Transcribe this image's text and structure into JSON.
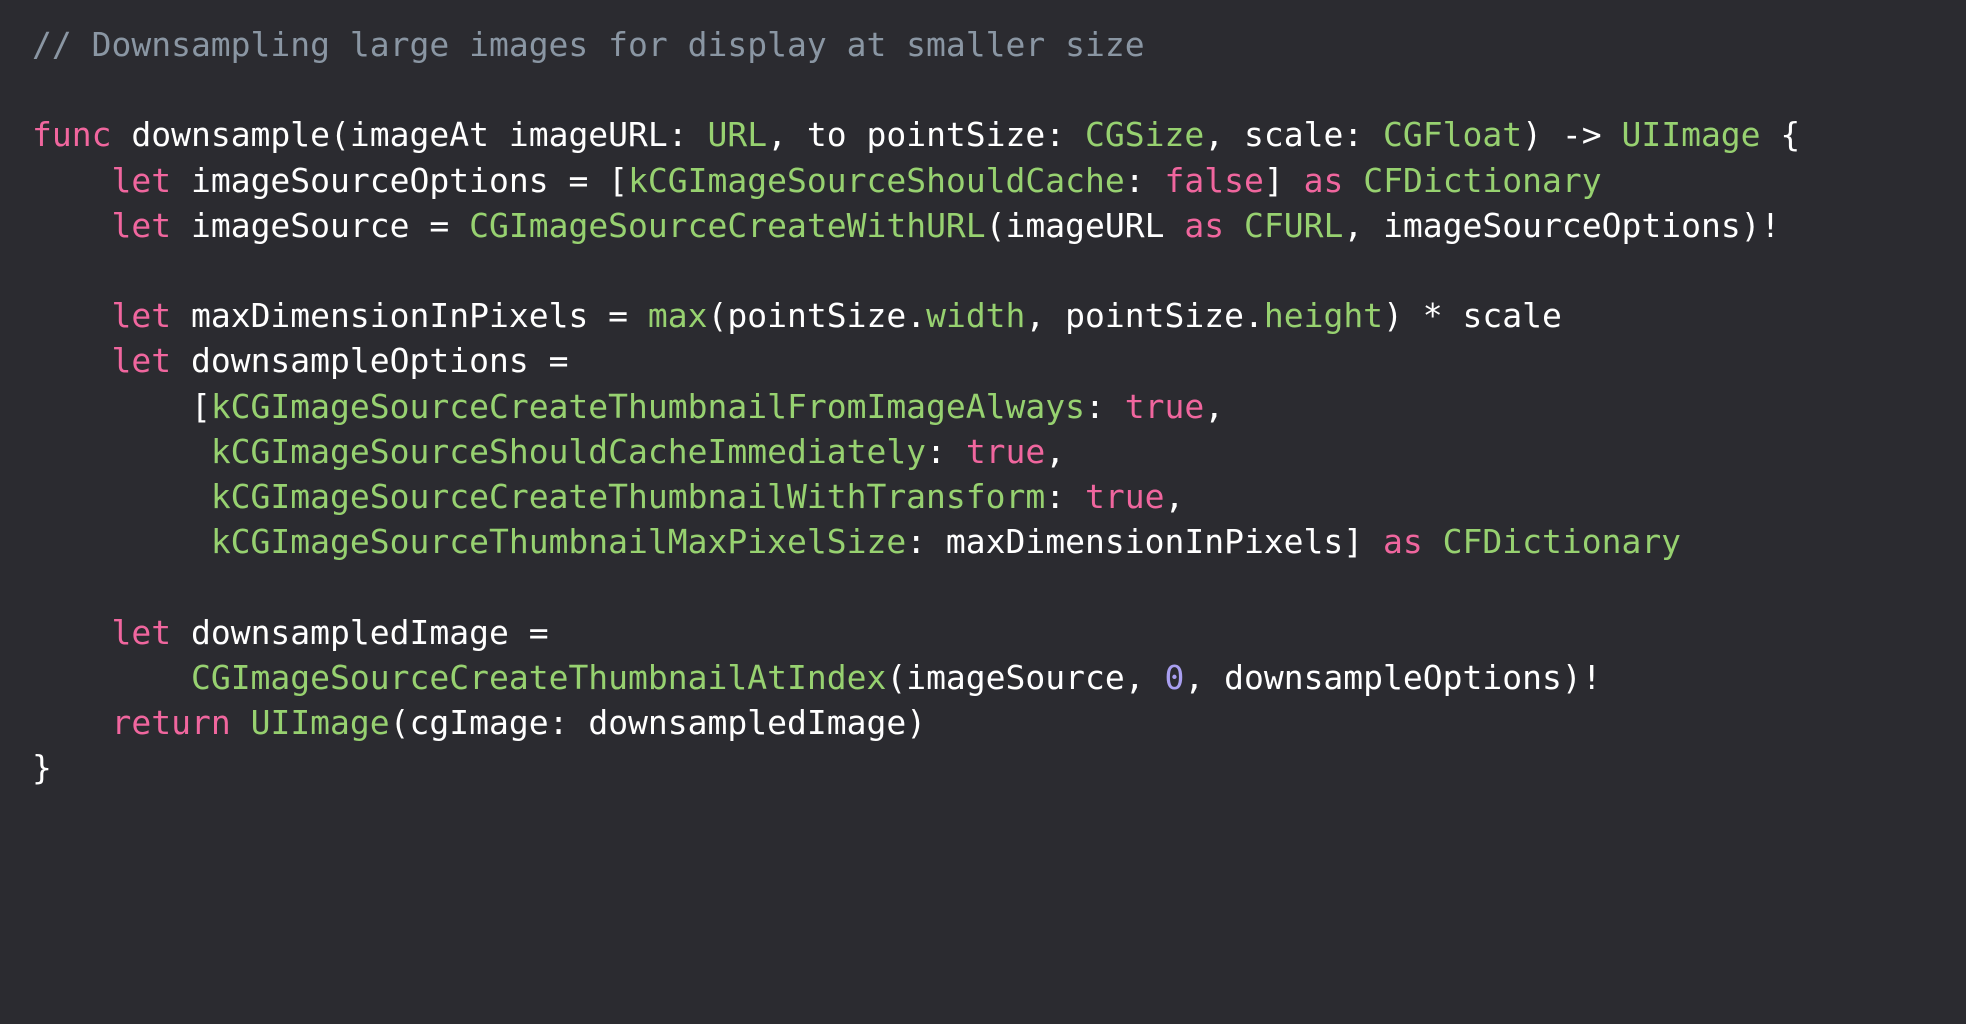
{
  "colors": {
    "background": "#2b2b30",
    "comment": "#8a96a3",
    "keyword": "#f0669e",
    "plain": "#ffffff",
    "type": "#97d170",
    "number": "#a99ff0"
  },
  "code": {
    "lines": [
      [
        {
          "t": "// Downsampling large images for display at smaller size",
          "k": "comment"
        }
      ],
      [],
      [
        {
          "t": "func",
          "k": "keyword"
        },
        {
          "t": " downsample(imageAt imageURL: ",
          "k": "plain"
        },
        {
          "t": "URL",
          "k": "type"
        },
        {
          "t": ", to pointSize: ",
          "k": "plain"
        },
        {
          "t": "CGSize",
          "k": "type"
        },
        {
          "t": ", scale: ",
          "k": "plain"
        },
        {
          "t": "CGFloat",
          "k": "type"
        },
        {
          "t": ") -> ",
          "k": "plain"
        },
        {
          "t": "UIImage",
          "k": "type"
        },
        {
          "t": " {",
          "k": "plain"
        }
      ],
      [
        {
          "t": "    ",
          "k": "plain"
        },
        {
          "t": "let",
          "k": "keyword"
        },
        {
          "t": " imageSourceOptions = [",
          "k": "plain"
        },
        {
          "t": "kCGImageSourceShouldCache",
          "k": "type"
        },
        {
          "t": ": ",
          "k": "plain"
        },
        {
          "t": "false",
          "k": "keyword"
        },
        {
          "t": "] ",
          "k": "plain"
        },
        {
          "t": "as",
          "k": "keyword"
        },
        {
          "t": " ",
          "k": "plain"
        },
        {
          "t": "CFDictionary",
          "k": "type"
        }
      ],
      [
        {
          "t": "    ",
          "k": "plain"
        },
        {
          "t": "let",
          "k": "keyword"
        },
        {
          "t": " imageSource = ",
          "k": "plain"
        },
        {
          "t": "CGImageSourceCreateWithURL",
          "k": "type"
        },
        {
          "t": "(imageURL ",
          "k": "plain"
        },
        {
          "t": "as",
          "k": "keyword"
        },
        {
          "t": " ",
          "k": "plain"
        },
        {
          "t": "CFURL",
          "k": "type"
        },
        {
          "t": ", imageSourceOptions)!",
          "k": "plain"
        }
      ],
      [],
      [
        {
          "t": "    ",
          "k": "plain"
        },
        {
          "t": "let",
          "k": "keyword"
        },
        {
          "t": " maxDimensionInPixels = ",
          "k": "plain"
        },
        {
          "t": "max",
          "k": "type"
        },
        {
          "t": "(pointSize.",
          "k": "plain"
        },
        {
          "t": "width",
          "k": "type"
        },
        {
          "t": ", pointSize.",
          "k": "plain"
        },
        {
          "t": "height",
          "k": "type"
        },
        {
          "t": ") * scale",
          "k": "plain"
        }
      ],
      [
        {
          "t": "    ",
          "k": "plain"
        },
        {
          "t": "let",
          "k": "keyword"
        },
        {
          "t": " downsampleOptions =",
          "k": "plain"
        }
      ],
      [
        {
          "t": "        [",
          "k": "plain"
        },
        {
          "t": "kCGImageSourceCreateThumbnailFromImageAlways",
          "k": "type"
        },
        {
          "t": ": ",
          "k": "plain"
        },
        {
          "t": "true",
          "k": "keyword"
        },
        {
          "t": ",",
          "k": "plain"
        }
      ],
      [
        {
          "t": "         ",
          "k": "plain"
        },
        {
          "t": "kCGImageSourceShouldCacheImmediately",
          "k": "type"
        },
        {
          "t": ": ",
          "k": "plain"
        },
        {
          "t": "true",
          "k": "keyword"
        },
        {
          "t": ",",
          "k": "plain"
        }
      ],
      [
        {
          "t": "         ",
          "k": "plain"
        },
        {
          "t": "kCGImageSourceCreateThumbnailWithTransform",
          "k": "type"
        },
        {
          "t": ": ",
          "k": "plain"
        },
        {
          "t": "true",
          "k": "keyword"
        },
        {
          "t": ",",
          "k": "plain"
        }
      ],
      [
        {
          "t": "         ",
          "k": "plain"
        },
        {
          "t": "kCGImageSourceThumbnailMaxPixelSize",
          "k": "type"
        },
        {
          "t": ": maxDimensionInPixels] ",
          "k": "plain"
        },
        {
          "t": "as",
          "k": "keyword"
        },
        {
          "t": " ",
          "k": "plain"
        },
        {
          "t": "CFDictionary",
          "k": "type"
        }
      ],
      [],
      [
        {
          "t": "    ",
          "k": "plain"
        },
        {
          "t": "let",
          "k": "keyword"
        },
        {
          "t": " downsampledImage =",
          "k": "plain"
        }
      ],
      [
        {
          "t": "        ",
          "k": "plain"
        },
        {
          "t": "CGImageSourceCreateThumbnailAtIndex",
          "k": "type"
        },
        {
          "t": "(imageSource, ",
          "k": "plain"
        },
        {
          "t": "0",
          "k": "number"
        },
        {
          "t": ", downsampleOptions)!",
          "k": "plain"
        }
      ],
      [
        {
          "t": "    ",
          "k": "plain"
        },
        {
          "t": "return",
          "k": "keyword"
        },
        {
          "t": " ",
          "k": "plain"
        },
        {
          "t": "UIImage",
          "k": "type"
        },
        {
          "t": "(cgImage: downsampledImage)",
          "k": "plain"
        }
      ],
      [
        {
          "t": "}",
          "k": "plain"
        }
      ]
    ]
  }
}
